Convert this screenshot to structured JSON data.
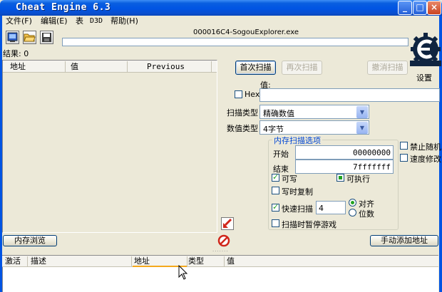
{
  "window": {
    "title": "Cheat Engine 6.3",
    "buttons": {
      "minimize": "_",
      "maximize": "□",
      "close": "×"
    }
  },
  "menu": [
    {
      "label": "文件(F)"
    },
    {
      "label": "编辑(E)"
    },
    {
      "label": "表"
    },
    {
      "label": "D3D"
    },
    {
      "label": "帮助(H)"
    }
  ],
  "toolbar": {
    "process_name": "000016C4-SogouExplorer.exe",
    "icons": [
      "open-process-icon",
      "open-file-icon",
      "save-icon"
    ]
  },
  "found_label": "结果: 0",
  "results": {
    "columns": [
      "地址",
      "值",
      "Previous"
    ]
  },
  "scan": {
    "first_scan": "首次扫描",
    "next_scan": "再次扫描",
    "undo_scan": "撤消扫描",
    "settings": "设置",
    "value_label": "值:",
    "hex_label": "Hex",
    "scan_type_label": "扫描类型",
    "scan_type_value": "精确数值",
    "value_type_label": "数值类型",
    "value_type_value": "4字节"
  },
  "memory_options": {
    "title": "内存扫描选项",
    "start_label": "开始",
    "start_value": "00000000",
    "stop_label": "结束",
    "stop_value": "7fffffff",
    "writable": "可写",
    "executable": "可执行",
    "copy_on_write": "写时复制",
    "fast_scan": "快速扫描",
    "fast_scan_value": "4",
    "align": "对齐",
    "last_digits": "位数",
    "pause_game": "扫描时暂停游戏"
  },
  "extra_options": {
    "no_random": "禁止随机",
    "speedhack": "速度修改"
  },
  "bottom": {
    "memory_view": "内存浏览",
    "add_address": "手动添加地址",
    "columns": [
      "激活",
      "描述",
      "地址",
      "类型",
      "值"
    ]
  },
  "colors": {
    "titlebar": "#0054e3",
    "window_bg": "#ece9d8",
    "group_title": "#0046d5",
    "check_mark": "#21a121"
  }
}
